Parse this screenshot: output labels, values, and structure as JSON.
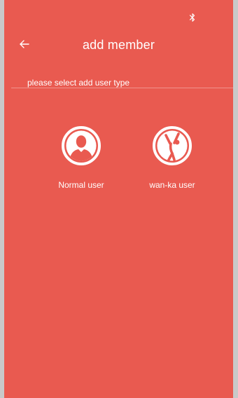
{
  "colors": {
    "background": "#e95a50",
    "foreground": "#ffffff",
    "outer": "#c9c9c9"
  },
  "status_bar": {
    "icons": [
      "bluetooth-icon"
    ]
  },
  "header": {
    "back_icon": "arrow-left-icon",
    "title": "add member"
  },
  "section": {
    "label": "please select add user type"
  },
  "user_types": [
    {
      "label": "Normal user",
      "icon": "person-bust-icon"
    },
    {
      "label": "wan-ka user",
      "icon": "person-waving-icon"
    }
  ]
}
